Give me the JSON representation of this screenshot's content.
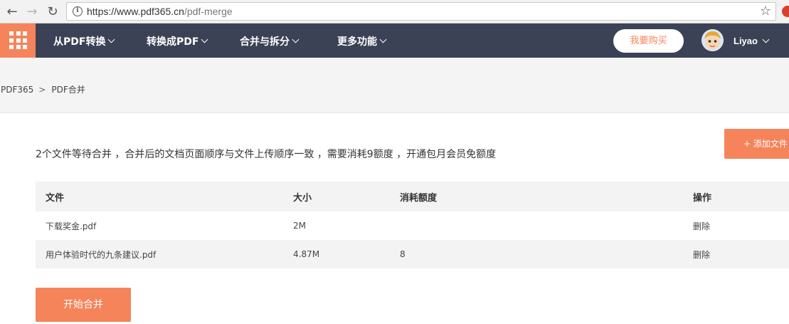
{
  "browser": {
    "url_host": "https://www.pdf365.cn",
    "url_path": "/pdf-merge"
  },
  "header": {
    "nav": [
      {
        "label": "从PDF转换"
      },
      {
        "label": "转换成PDF"
      },
      {
        "label": "合并与拆分"
      },
      {
        "label": "更多功能"
      }
    ],
    "buy_label": "我要购买",
    "user_name": "Liyao"
  },
  "breadcrumb": {
    "home": "PDF365",
    "separator": ">",
    "current": "PDF合并"
  },
  "main": {
    "add_button": "+ 添加文件",
    "description": "2个文件等待合并 ，合并后的文档页面顺序与文件上传顺序一致 ，需要消耗9额度 ，开通包月会员免额度",
    "table": {
      "headers": [
        "文件",
        "大小",
        "消耗额度",
        "操作"
      ],
      "rows": [
        {
          "name": "下载奖金.pdf",
          "size": "2M",
          "cost": "",
          "action": "删除"
        },
        {
          "name": "用户体验时代的九条建议.pdf",
          "size": "4.87M",
          "cost": "8",
          "action": "删除"
        }
      ]
    },
    "start_button": "开始合并"
  },
  "colors": {
    "accent": "#f5845b",
    "header_bg": "#3b4256"
  }
}
